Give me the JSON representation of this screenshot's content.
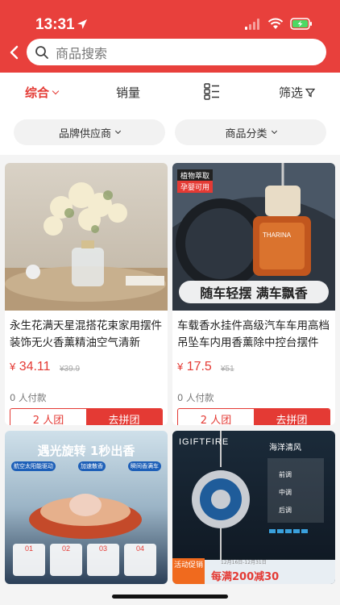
{
  "status_bar": {
    "time": "13:31"
  },
  "search": {
    "placeholder": "商品搜索"
  },
  "sort_tabs": [
    {
      "label": "综合",
      "active": true
    },
    {
      "label": "销量"
    },
    {
      "label": "筛选"
    }
  ],
  "filters": [
    {
      "label": "品牌供应商"
    },
    {
      "label": "商品分类"
    }
  ],
  "products": [
    {
      "title": "永生花满天星混搭花束家用摆件装饰无火香薰精油空气清新",
      "price_symbol": "¥",
      "price": "34.11",
      "original_price": "¥39.9",
      "sold": "0 人付款",
      "group_size": "2 人团",
      "group_button": "去拼团"
    },
    {
      "title": "车载香水挂件高级汽车车用高档吊坠车内用香薰除中控台摆件",
      "price_symbol": "¥",
      "price": "17.5",
      "original_price": "¥51",
      "sold": "0 人付款",
      "group_size": "2 人团",
      "group_button": "去拼团",
      "img_badge_1": "植物萃取",
      "img_badge_2": "孕婴可用",
      "img_banner": "随车轻摆 满车飘香",
      "img_brand": "THARINA"
    },
    {
      "img_headline": "遇光旋转 1秒出香",
      "img_tags": [
        "航空太阳能驱动",
        "加速散香",
        "瞬间香满车"
      ],
      "img_steps": [
        "01",
        "02",
        "03",
        "04"
      ]
    },
    {
      "img_brand": "IGIFTFIRE",
      "img_title": "海洋清风",
      "img_notes": [
        "前调",
        "中调",
        "后调"
      ],
      "img_promo": "活动促销",
      "img_promo_offer": "每满200减30",
      "img_dates": "12月16日-12月31日"
    }
  ],
  "colors": {
    "brand_red": "#e8403c",
    "price_red": "#e43a34"
  }
}
